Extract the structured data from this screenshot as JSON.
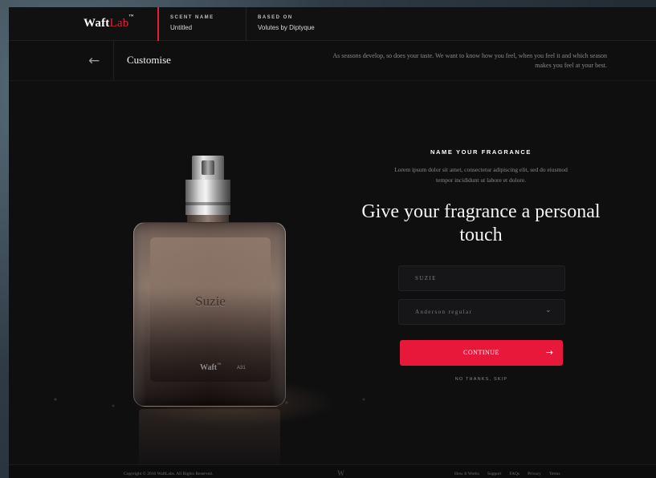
{
  "header": {
    "logo_main": "Waft",
    "logo_accent": "Lab",
    "logo_tm": "™",
    "scent_name_label": "SCENT NAME",
    "scent_name_value": "Untitled",
    "based_on_label": "BASED ON",
    "based_on_value": "Volutes by Diptyque"
  },
  "subheader": {
    "back_icon": "←",
    "title": "Customise",
    "description": "As seasons develop, so does your taste. We want to know how you feel, when you feel it and which season makes you feel at your best."
  },
  "bottle": {
    "name": "Suzie",
    "brand": "Waft",
    "brand_tm": "™",
    "code": "A31"
  },
  "form": {
    "eyebrow": "NAME YOUR FRAGRANCE",
    "lead": "Lorem ipsum dolor sit amet, consectetur adipiscing elit, sed do eiusmod tempor incididunt ut labore et dolore.",
    "headline": "Give your fragrance a personal touch",
    "name_value": "SUZIE",
    "font_value": "Anderson regular",
    "chevron": "⌄",
    "continue_label": "CONTINUE",
    "continue_arrow": "→",
    "skip_label": "NO THANKS, SKIP"
  },
  "footer": {
    "copyright": "Copyright © 2016 WaftLabs. All Rights Reserved.",
    "mark": "W",
    "links": [
      "How It Works",
      "Support",
      "FAQs",
      "Privacy",
      "Terms"
    ]
  },
  "colors": {
    "accent": "#e8183a",
    "background": "#0f0f10"
  }
}
